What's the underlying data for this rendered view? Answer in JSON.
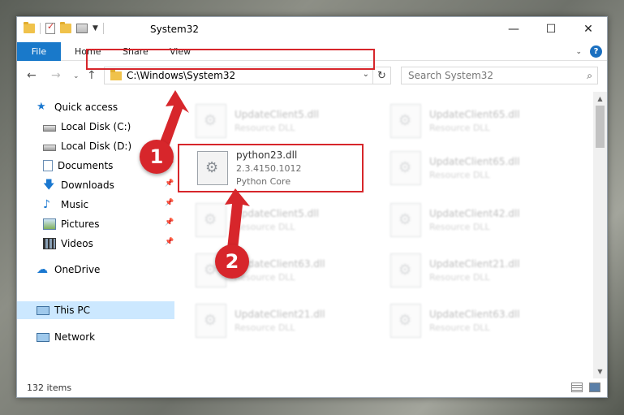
{
  "window": {
    "title": "System32",
    "controls": {
      "minimize": "—",
      "maximize": "☐",
      "close": "✕"
    }
  },
  "ribbon": {
    "tabs": [
      "File",
      "Home",
      "Share",
      "View"
    ]
  },
  "address": {
    "path": "C:\\Windows\\System32"
  },
  "search": {
    "placeholder": "Search System32"
  },
  "sidebar": {
    "items": [
      {
        "label": "Quick access",
        "icon": "star-icon"
      },
      {
        "label": "Local Disk (C:)",
        "icon": "drive-icon"
      },
      {
        "label": "Local Disk (D:)",
        "icon": "drive-icon"
      },
      {
        "label": "Documents",
        "icon": "documents-icon",
        "pinned": true
      },
      {
        "label": "Downloads",
        "icon": "download-icon",
        "pinned": true
      },
      {
        "label": "Music",
        "icon": "music-icon",
        "pinned": true
      },
      {
        "label": "Pictures",
        "icon": "pictures-icon",
        "pinned": true
      },
      {
        "label": "Videos",
        "icon": "video-icon",
        "pinned": true
      },
      {
        "label": "OneDrive",
        "icon": "cloud-icon"
      },
      {
        "label": "This PC",
        "icon": "computer-icon",
        "selected": true
      },
      {
        "label": "Network",
        "icon": "network-icon"
      }
    ]
  },
  "files": [
    {
      "name": "UpdateClient5.dll",
      "desc": "Resource DLL"
    },
    {
      "name": "UpdateClient65.dll",
      "desc": "Resource DLL"
    },
    {
      "name": "python23.dll",
      "version": "2.3.4150.1012",
      "desc": "Python Core",
      "focused": true
    },
    {
      "name": "UpdateClient65.dll",
      "desc": "Resource DLL"
    },
    {
      "name": "UpdateClient5.dll",
      "desc": "Resource DLL"
    },
    {
      "name": "UpdateClient42.dll",
      "desc": "Resource DLL"
    },
    {
      "name": "UpdateClient63.dll",
      "desc": "Resource DLL"
    },
    {
      "name": "UpdateClient21.dll",
      "desc": "Resource DLL"
    },
    {
      "name": "UpdateClient21.dll",
      "desc": "Resource DLL"
    },
    {
      "name": "UpdateClient63.dll",
      "desc": "Resource DLL"
    }
  ],
  "status": {
    "items": "132 items"
  },
  "annotations": {
    "step1": "1",
    "step2": "2",
    "color": "#d7262b"
  }
}
